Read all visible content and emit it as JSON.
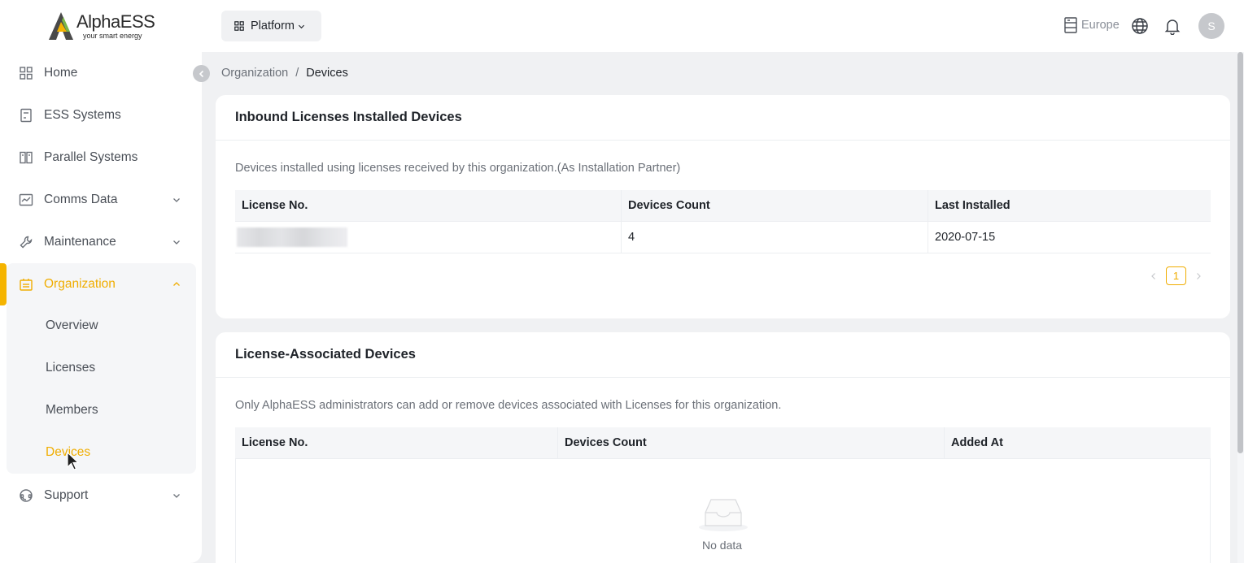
{
  "brand": {
    "name": "AlphaESS",
    "tagline": "your smart energy",
    "accent": "#f0ad00"
  },
  "sidebar": {
    "items": [
      {
        "label": "Home",
        "icon": "grid-icon"
      },
      {
        "label": "ESS Systems",
        "icon": "document-icon"
      },
      {
        "label": "Parallel Systems",
        "icon": "book-icon"
      },
      {
        "label": "Comms Data",
        "icon": "chart-icon"
      },
      {
        "label": "Maintenance",
        "icon": "wrench-icon"
      },
      {
        "label": "Organization",
        "icon": "building-icon"
      },
      {
        "label": "Support",
        "icon": "headset-icon"
      }
    ],
    "organization_sub": [
      "Overview",
      "Licenses",
      "Members",
      "Devices"
    ]
  },
  "topbar": {
    "platform_label": "Platform",
    "region_label": "Europe",
    "avatar_initial": "S"
  },
  "breadcrumb": {
    "parent": "Organization",
    "separator": "/",
    "current": "Devices"
  },
  "inbound": {
    "title": "Inbound Licenses Installed Devices",
    "description": "Devices installed using licenses received by this organization.(As Installation Partner)",
    "columns": [
      "License No.",
      "Devices Count",
      "Last Installed"
    ],
    "rows": [
      {
        "license": "",
        "count": "4",
        "last_installed": "2020-07-15"
      }
    ],
    "page": "1"
  },
  "associated": {
    "title": "License-Associated Devices",
    "description": "Only AlphaESS administrators can add or remove devices associated with Licenses for this organization.",
    "columns": [
      "License No.",
      "Devices Count",
      "Added At"
    ],
    "empty_text": "No data"
  }
}
